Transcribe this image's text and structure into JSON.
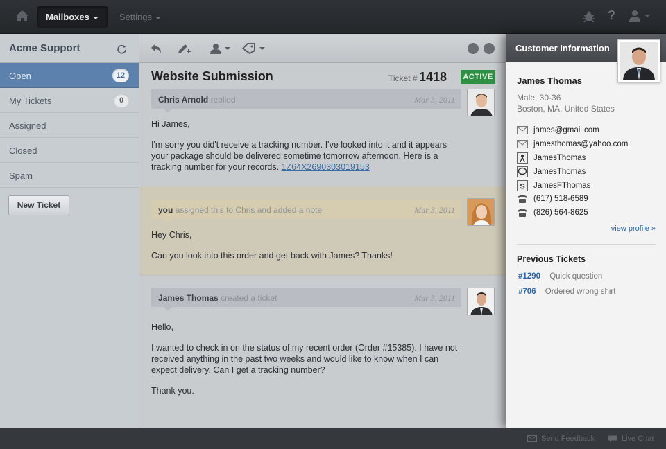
{
  "topbar": {
    "nav": {
      "mailboxes": "Mailboxes",
      "settings": "Settings"
    },
    "icons": {
      "home": "home-icon",
      "bug": "bug-icon",
      "help": "?",
      "user": "user-icon"
    }
  },
  "sidebar": {
    "title": "Acme Support",
    "items": [
      {
        "label": "Open",
        "count": "12",
        "active": true
      },
      {
        "label": "My Tickets",
        "count": "0"
      },
      {
        "label": "Assigned"
      },
      {
        "label": "Closed"
      },
      {
        "label": "Spam"
      }
    ],
    "new_ticket": "New Ticket"
  },
  "ticket": {
    "subject": "Website Submission",
    "number_label": "Ticket #",
    "number": "1418",
    "status": "ACTIVE",
    "status_color": "#2f8f45",
    "messages": [
      {
        "author": "Chris Arnold",
        "action": "replied",
        "date": "Mar 3, 2011",
        "greeting": "Hi James,",
        "body": "I'm sorry you did't receive a tracking number.  I've looked into it and it appears your package should be delivered sometime tomorrow afternoon.  Here is a tracking number for your records.",
        "link": "1Z64X2690303019153"
      },
      {
        "author": "you",
        "action": "assigned this to Chris and added a note",
        "date": "Mar 3, 2011",
        "greeting": "Hey Chris,",
        "body": "Can you look into this order and get back with James?  Thanks!"
      },
      {
        "author": "James Thomas",
        "action": "created a ticket",
        "date": "Mar 3, 2011",
        "greeting": "Hello,",
        "body": "I wanted to check in on the status of my recent order (Order #15385).  I have not received anything in the past two weeks and would like to know when I can expect delivery.  Can I get a tracking number?",
        "closing": "Thank you."
      }
    ]
  },
  "customer": {
    "panel_title": "Customer Information",
    "name": "James Thomas",
    "demographics": "Male, 30-36",
    "location": "Boston, MA, United States",
    "contacts": [
      {
        "icon": "email-icon",
        "value": "james@gmail.com"
      },
      {
        "icon": "email-icon",
        "value": "jamesthomas@yahoo.com"
      },
      {
        "icon": "aim-icon",
        "value": "JamesThomas"
      },
      {
        "icon": "chat-icon",
        "value": "JamesThomas"
      },
      {
        "icon": "skype-icon",
        "value": "JamesFThomas"
      },
      {
        "icon": "phone-icon",
        "value": "(617) 518-6589"
      },
      {
        "icon": "phone-icon",
        "value": "(826) 564-8625"
      }
    ],
    "view_profile": "view profile »",
    "previous_title": "Previous Tickets",
    "previous": [
      {
        "id": "#1290",
        "subject": "Quick question"
      },
      {
        "id": "#706",
        "subject": "Ordered wrong shirt"
      }
    ]
  },
  "footer": {
    "feedback": "Send Feedback",
    "chat": "Live Chat"
  }
}
